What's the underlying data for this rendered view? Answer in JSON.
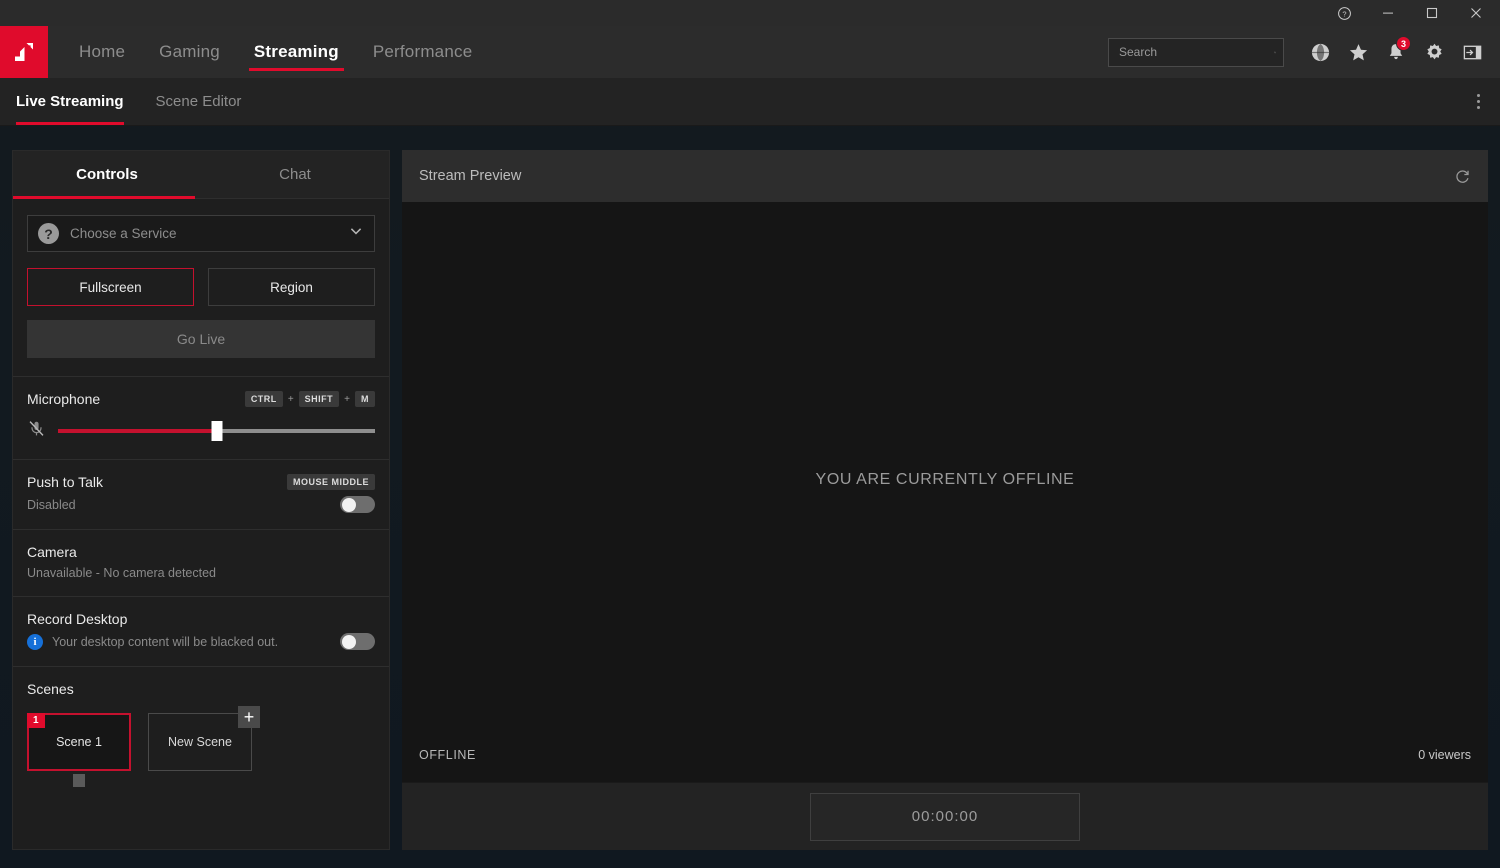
{
  "titlebar": {
    "help_label": "Help",
    "minimize_label": "Minimize",
    "maximize_label": "Maximize",
    "close_label": "Close"
  },
  "mainnav": {
    "logo_alt": "AMD Radeon Software",
    "items": [
      {
        "label": "Home",
        "active": false
      },
      {
        "label": "Gaming",
        "active": false
      },
      {
        "label": "Streaming",
        "active": true
      },
      {
        "label": "Performance",
        "active": false
      }
    ],
    "search": {
      "value": "",
      "placeholder": "Search"
    },
    "icons": [
      {
        "name": "globe-icon",
        "label": "Social"
      },
      {
        "name": "star-icon",
        "label": "Favorites"
      },
      {
        "name": "bell-icon",
        "label": "Notifications",
        "badge": "3"
      },
      {
        "name": "gear-icon",
        "label": "Settings"
      },
      {
        "name": "panel-toggle-icon",
        "label": "Collapse"
      }
    ]
  },
  "subnav": {
    "items": [
      {
        "label": "Live Streaming",
        "active": true
      },
      {
        "label": "Scene Editor",
        "active": false
      }
    ],
    "more_label": "More options"
  },
  "controls": {
    "tabs": [
      {
        "label": "Controls",
        "active": true
      },
      {
        "label": "Chat",
        "active": false
      }
    ],
    "service": {
      "label": "Choose a Service",
      "icon": "question-circle-icon",
      "chevron": "chevron-down-icon"
    },
    "capture_buttons": [
      {
        "label": "Fullscreen",
        "selected": true
      },
      {
        "label": "Region",
        "selected": false
      }
    ],
    "go_live_label": "Go Live",
    "microphone": {
      "title": "Microphone",
      "icon": "microphone-muted-icon",
      "shortcut": [
        "CTRL",
        "SHIFT",
        "M"
      ],
      "shortcut_separator": "+",
      "level_percent": 50
    },
    "push_to_talk": {
      "title": "Push to Talk",
      "shortcut": "MOUSE MIDDLE",
      "status": "Disabled",
      "enabled": false
    },
    "camera": {
      "title": "Camera",
      "status": "Unavailable - No camera detected"
    },
    "record_desktop": {
      "title": "Record Desktop",
      "info_icon": "info-icon",
      "info_text": "Your desktop content will be blacked out.",
      "enabled": false
    },
    "scenes": {
      "title": "Scenes",
      "items": [
        {
          "number": "1",
          "label": "Scene 1",
          "selected": true
        }
      ],
      "new_scene_label": "New Scene",
      "add_icon": "plus-icon"
    }
  },
  "preview": {
    "title": "Stream Preview",
    "refresh_icon": "refresh-icon",
    "offline_message": "YOU ARE CURRENTLY OFFLINE",
    "status_label": "OFFLINE",
    "viewers": "0 viewers",
    "timer": "00:00:00"
  },
  "colors": {
    "accent_red": "#e00b2c",
    "selected_border": "#c4112e",
    "badge_blue": "#1670d8"
  }
}
